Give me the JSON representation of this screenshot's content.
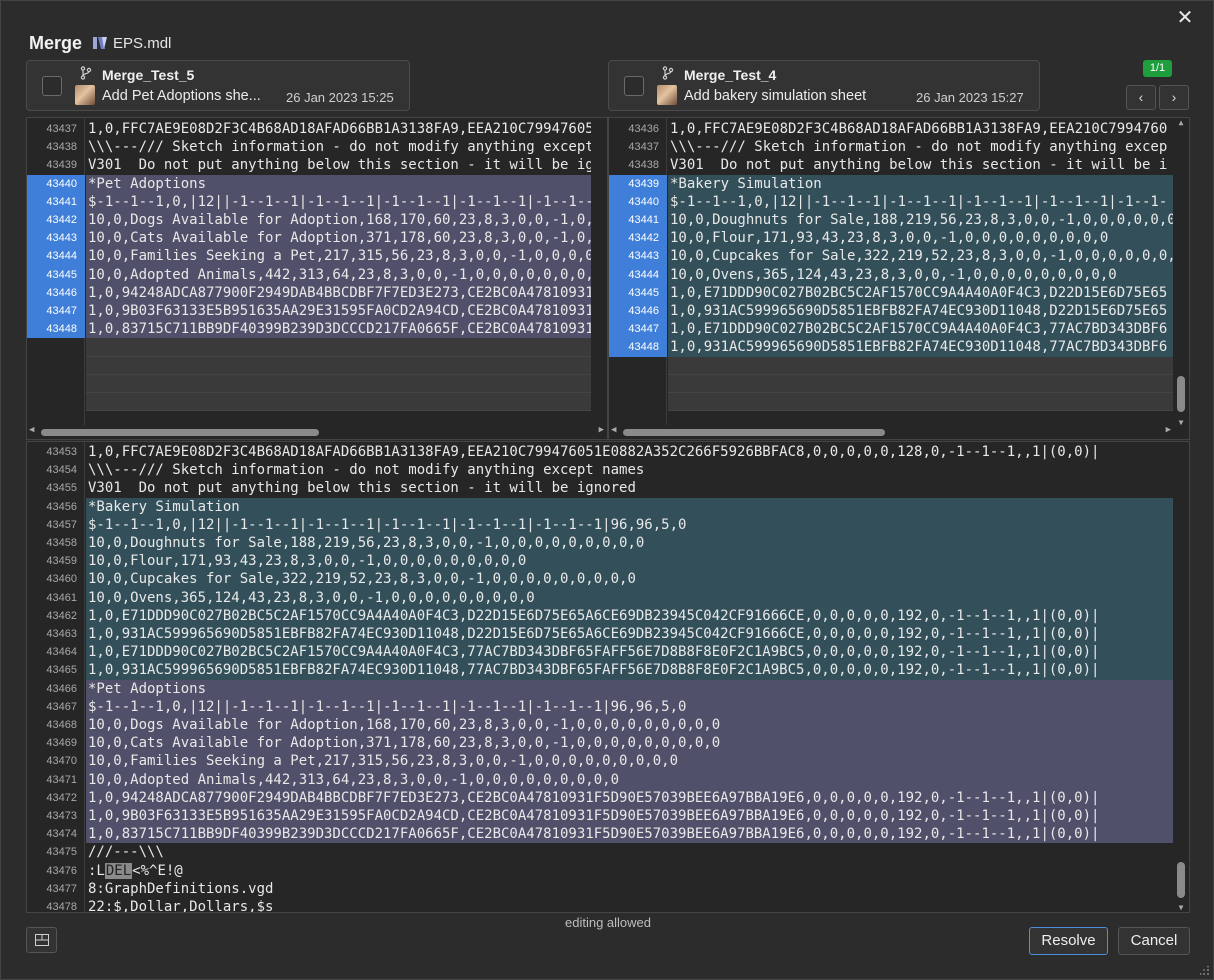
{
  "dialog": {
    "title": "Merge",
    "file_name": "EPS.mdl",
    "status_text": "editing allowed",
    "resolve_label": "Resolve",
    "cancel_label": "Cancel",
    "conflict_counter": "1/1",
    "close_glyph": "✕",
    "prev_glyph": "‹",
    "next_glyph": "›"
  },
  "left_revision": {
    "branch": "Merge_Test_5",
    "message": "Add Pet Adoptions she...",
    "date": "26 Jan 2023 15:25"
  },
  "right_revision": {
    "branch": "Merge_Test_4",
    "message": "Add bakery simulation sheet",
    "date": "26 Jan 2023 15:27"
  },
  "left_pane": {
    "lines": [
      {
        "n": "43437",
        "t": "1,0,FFC7AE9E08D2F3C4B68AD18AFAD66BB1A3138FA9,EEA210C799476051",
        "k": "plain"
      },
      {
        "n": "43438",
        "t": "\\\\\\---/// Sketch information - do not modify anything except",
        "k": "plain"
      },
      {
        "n": "43439",
        "t": "V301  Do not put anything below this section - it will be igr",
        "k": "plain"
      },
      {
        "n": "43440",
        "t": "*Pet Adoptions",
        "k": "purple"
      },
      {
        "n": "43441",
        "t": "$-1--1--1,0,|12||-1--1--1|-1--1--1|-1--1--1|-1--1--1|-1--1--",
        "k": "purple"
      },
      {
        "n": "43442",
        "t": "10,0,Dogs Available for Adoption,168,170,60,23,8,3,0,0,-1,0,0",
        "k": "purple"
      },
      {
        "n": "43443",
        "t": "10,0,Cats Available for Adoption,371,178,60,23,8,3,0,0,-1,0,0",
        "k": "purple"
      },
      {
        "n": "43444",
        "t": "10,0,Families Seeking a Pet,217,315,56,23,8,3,0,0,-1,0,0,0,0,",
        "k": "purple"
      },
      {
        "n": "43445",
        "t": "10,0,Adopted Animals,442,313,64,23,8,3,0,0,-1,0,0,0,0,0,0,0,0",
        "k": "purple"
      },
      {
        "n": "43446",
        "t": "1,0,94248ADCA877900F2949DAB4BBCDBF7F7ED3E273,CE2BC0A47810931F",
        "k": "purple"
      },
      {
        "n": "43447",
        "t": "1,0,9B03F63133E5B951635AA29E31595FA0CD2A94CD,CE2BC0A47810931F",
        "k": "purple"
      },
      {
        "n": "43448",
        "t": "1,0,83715C711BB9DF40399B239D3DCCCD217FA0665F,CE2BC0A47810931F",
        "k": "purple"
      }
    ]
  },
  "right_pane": {
    "lines": [
      {
        "n": "43436",
        "t": "1,0,FFC7AE9E08D2F3C4B68AD18AFAD66BB1A3138FA9,EEA210C7994760",
        "k": "plain"
      },
      {
        "n": "43437",
        "t": "\\\\\\---/// Sketch information - do not modify anything excep",
        "k": "plain"
      },
      {
        "n": "43438",
        "t": "V301  Do not put anything below this section - it will be i",
        "k": "plain"
      },
      {
        "n": "43439",
        "t": "*Bakery Simulation",
        "k": "teal"
      },
      {
        "n": "43440",
        "t": "$-1--1--1,0,|12||-1--1--1|-1--1--1|-1--1--1|-1--1--1|-1--1-",
        "k": "teal"
      },
      {
        "n": "43441",
        "t": "10,0,Doughnuts for Sale,188,219,56,23,8,3,0,0,-1,0,0,0,0,0,0,",
        "k": "teal"
      },
      {
        "n": "43442",
        "t": "10,0,Flour,171,93,43,23,8,3,0,0,-1,0,0,0,0,0,0,0,0,0",
        "k": "teal"
      },
      {
        "n": "43443",
        "t": "10,0,Cupcakes for Sale,322,219,52,23,8,3,0,0,-1,0,0,0,0,0,0,0",
        "k": "teal"
      },
      {
        "n": "43444",
        "t": "10,0,Ovens,365,124,43,23,8,3,0,0,-1,0,0,0,0,0,0,0,0,0",
        "k": "teal"
      },
      {
        "n": "43445",
        "t": "1,0,E71DDD90C027B02BC5C2AF1570CC9A4A40A0F4C3,D22D15E6D75E65",
        "k": "teal"
      },
      {
        "n": "43446",
        "t": "1,0,931AC599965690D5851EBFB82FA74EC930D11048,D22D15E6D75E65",
        "k": "teal"
      },
      {
        "n": "43447",
        "t": "1,0,E71DDD90C027B02BC5C2AF1570CC9A4A40A0F4C3,77AC7BD343DBF6",
        "k": "teal"
      },
      {
        "n": "43448",
        "t": "1,0,931AC599965690D5851EBFB82FA74EC930D11048,77AC7BD343DBF6",
        "k": "teal"
      }
    ]
  },
  "result_pane": {
    "lines": [
      {
        "n": "43453",
        "t": "1,0,FFC7AE9E08D2F3C4B68AD18AFAD66BB1A3138FA9,EEA210C799476051E0882A352C266F5926BBFAC8,0,0,0,0,0,128,0,-1--1--1,,1|(0,0)|",
        "k": "plain"
      },
      {
        "n": "43454",
        "t": "\\\\\\---/// Sketch information - do not modify anything except names",
        "k": "plain"
      },
      {
        "n": "43455",
        "t": "V301  Do not put anything below this section - it will be ignored",
        "k": "plain"
      },
      {
        "n": "43456",
        "t": "*Bakery Simulation",
        "k": "teal"
      },
      {
        "n": "43457",
        "t": "$-1--1--1,0,|12||-1--1--1|-1--1--1|-1--1--1|-1--1--1|-1--1--1|96,96,5,0",
        "k": "teal"
      },
      {
        "n": "43458",
        "t": "10,0,Doughnuts for Sale,188,219,56,23,8,3,0,0,-1,0,0,0,0,0,0,0,0,0",
        "k": "teal"
      },
      {
        "n": "43459",
        "t": "10,0,Flour,171,93,43,23,8,3,0,0,-1,0,0,0,0,0,0,0,0,0",
        "k": "teal"
      },
      {
        "n": "43460",
        "t": "10,0,Cupcakes for Sale,322,219,52,23,8,3,0,0,-1,0,0,0,0,0,0,0,0,0",
        "k": "teal"
      },
      {
        "n": "43461",
        "t": "10,0,Ovens,365,124,43,23,8,3,0,0,-1,0,0,0,0,0,0,0,0,0",
        "k": "teal"
      },
      {
        "n": "43462",
        "t": "1,0,E71DDD90C027B02BC5C2AF1570CC9A4A40A0F4C3,D22D15E6D75E65A6CE69DB23945C042CF91666CE,0,0,0,0,0,192,0,-1--1--1,,1|(0,0)|",
        "k": "teal"
      },
      {
        "n": "43463",
        "t": "1,0,931AC599965690D5851EBFB82FA74EC930D11048,D22D15E6D75E65A6CE69DB23945C042CF91666CE,0,0,0,0,0,192,0,-1--1--1,,1|(0,0)|",
        "k": "teal"
      },
      {
        "n": "43464",
        "t": "1,0,E71DDD90C027B02BC5C2AF1570CC9A4A40A0F4C3,77AC7BD343DBF65FAFF56E7D8B8F8E0F2C1A9BC5,0,0,0,0,0,192,0,-1--1--1,,1|(0,0)|",
        "k": "teal"
      },
      {
        "n": "43465",
        "t": "1,0,931AC599965690D5851EBFB82FA74EC930D11048,77AC7BD343DBF65FAFF56E7D8B8F8E0F2C1A9BC5,0,0,0,0,0,192,0,-1--1--1,,1|(0,0)|",
        "k": "teal"
      },
      {
        "n": "43466",
        "t": "*Pet Adoptions",
        "k": "purple"
      },
      {
        "n": "43467",
        "t": "$-1--1--1,0,|12||-1--1--1|-1--1--1|-1--1--1|-1--1--1|-1--1--1|96,96,5,0",
        "k": "purple"
      },
      {
        "n": "43468",
        "t": "10,0,Dogs Available for Adoption,168,170,60,23,8,3,0,0,-1,0,0,0,0,0,0,0,0,0",
        "k": "purple"
      },
      {
        "n": "43469",
        "t": "10,0,Cats Available for Adoption,371,178,60,23,8,3,0,0,-1,0,0,0,0,0,0,0,0,0",
        "k": "purple"
      },
      {
        "n": "43470",
        "t": "10,0,Families Seeking a Pet,217,315,56,23,8,3,0,0,-1,0,0,0,0,0,0,0,0,0",
        "k": "purple"
      },
      {
        "n": "43471",
        "t": "10,0,Adopted Animals,442,313,64,23,8,3,0,0,-1,0,0,0,0,0,0,0,0,0",
        "k": "purple"
      },
      {
        "n": "43472",
        "t": "1,0,94248ADCA877900F2949DAB4BBCDBF7F7ED3E273,CE2BC0A47810931F5D90E57039BEE6A97BBA19E6,0,0,0,0,0,192,0,-1--1--1,,1|(0,0)|",
        "k": "purple"
      },
      {
        "n": "43473",
        "t": "1,0,9B03F63133E5B951635AA29E31595FA0CD2A94CD,CE2BC0A47810931F5D90E57039BEE6A97BBA19E6,0,0,0,0,0,192,0,-1--1--1,,1|(0,0)|",
        "k": "purple"
      },
      {
        "n": "43474",
        "t": "1,0,83715C711BB9DF40399B239D3DCCCD217FA0665F,CE2BC0A47810931F5D90E57039BEE6A97BBA19E6,0,0,0,0,0,192,0,-1--1--1,,1|(0,0)|",
        "k": "purple"
      },
      {
        "n": "43475",
        "t": "///---\\\\\\",
        "k": "plain"
      },
      {
        "n": "43476",
        "t": ":L",
        "k": "del",
        "del": "DEL",
        "after": "<%^E!@"
      },
      {
        "n": "43477",
        "t": "8:GraphDefinitions.vgd",
        "k": "plain"
      },
      {
        "n": "43478",
        "t": "22:$,Dollar,Dollars,$s",
        "k": "plain"
      }
    ]
  },
  "icons": {
    "close": "close-icon",
    "file": "model-file-icon",
    "branch": "branch-icon",
    "avatar": "avatar",
    "layout": "layout-split-icon"
  },
  "colors": {
    "accent": "#3f7fd9",
    "left_change": "#50506a",
    "right_change": "#33505a",
    "badge": "#1f9e3e"
  }
}
